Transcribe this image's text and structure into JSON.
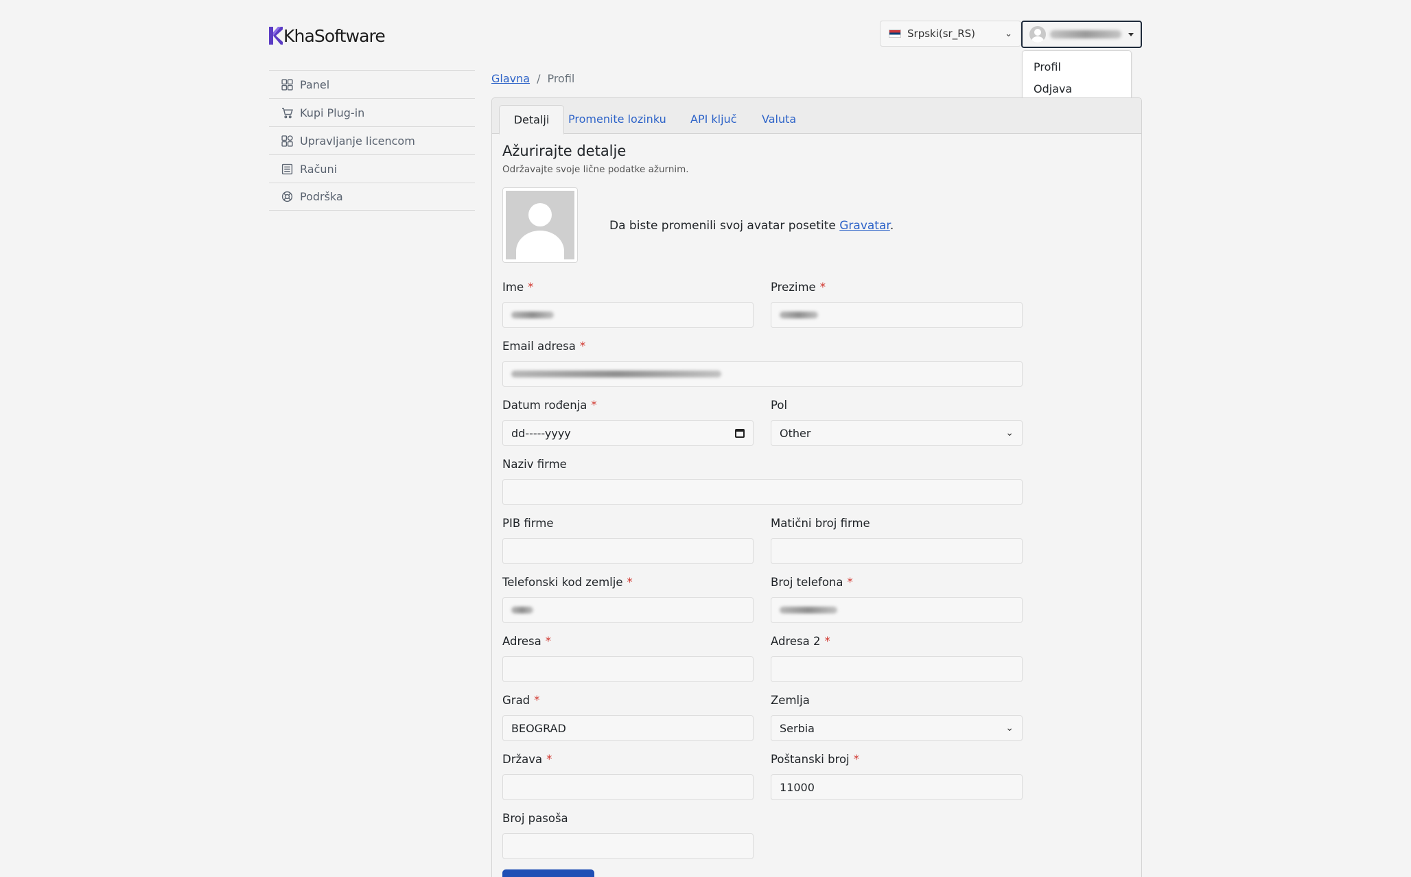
{
  "brand": {
    "name": "KhaSoftware",
    "logo_color": "#5b3cc4"
  },
  "header": {
    "language": {
      "label": "Srpski(sr_RS)",
      "flag_icon": "serbia-flag-icon"
    },
    "user_menu": {
      "items": [
        "Profil",
        "Odjava"
      ]
    }
  },
  "sidebar": {
    "items": [
      {
        "label": "Panel",
        "icon": "dashboard-icon"
      },
      {
        "label": "Kupi Plug-in",
        "icon": "cart-icon"
      },
      {
        "label": "Upravljanje licencom",
        "icon": "license-icon"
      },
      {
        "label": "Računi",
        "icon": "invoice-icon"
      },
      {
        "label": "Podrška",
        "icon": "support-icon"
      }
    ]
  },
  "breadcrumb": {
    "home": "Glavna",
    "separator": "/",
    "current": "Profil"
  },
  "tabs": [
    "Detalji",
    "Promenite lozinku",
    "API ključ",
    "Valuta"
  ],
  "details": {
    "title": "Ažurirajte detalje",
    "subtitle": "Održavajte svoje lične podatke ažurnim.",
    "avatar_note_prefix": "Da biste promenili svoj avatar posetite ",
    "avatar_link": "Gravatar",
    "avatar_note_suffix": "."
  },
  "required_mark": "*",
  "form": {
    "first_name": {
      "label": "Ime",
      "required": true,
      "value": ""
    },
    "last_name": {
      "label": "Prezime",
      "required": true,
      "value": ""
    },
    "email": {
      "label": "Email adresa",
      "required": true,
      "value": ""
    },
    "birth_date": {
      "label": "Datum rođenja",
      "required": true,
      "placeholder": "dd-----yyyy"
    },
    "gender": {
      "label": "Pol",
      "value": "Other"
    },
    "company_name": {
      "label": "Naziv firme",
      "value": ""
    },
    "company_pib": {
      "label": "PIB firme",
      "value": ""
    },
    "company_reg": {
      "label": "Matični broj firme",
      "value": ""
    },
    "phone_code": {
      "label": "Telefonski kod zemlje",
      "required": true,
      "value": ""
    },
    "phone": {
      "label": "Broj telefona",
      "required": true,
      "value": ""
    },
    "address": {
      "label": "Adresa",
      "required": true,
      "value": ""
    },
    "address2": {
      "label": "Adresa 2",
      "required": true,
      "value": ""
    },
    "city": {
      "label": "Grad",
      "required": true,
      "value": "BEOGRAD"
    },
    "country": {
      "label": "Zemlja",
      "value": "Serbia"
    },
    "state": {
      "label": "Država",
      "required": true,
      "value": ""
    },
    "postal_code": {
      "label": "Poštanski broj",
      "required": true,
      "value": "11000"
    },
    "passport": {
      "label": "Broj pasoša",
      "value": ""
    }
  },
  "colors": {
    "link": "#2d63c8",
    "required": "#d0342c",
    "primary_button": "#1f4fb5"
  }
}
